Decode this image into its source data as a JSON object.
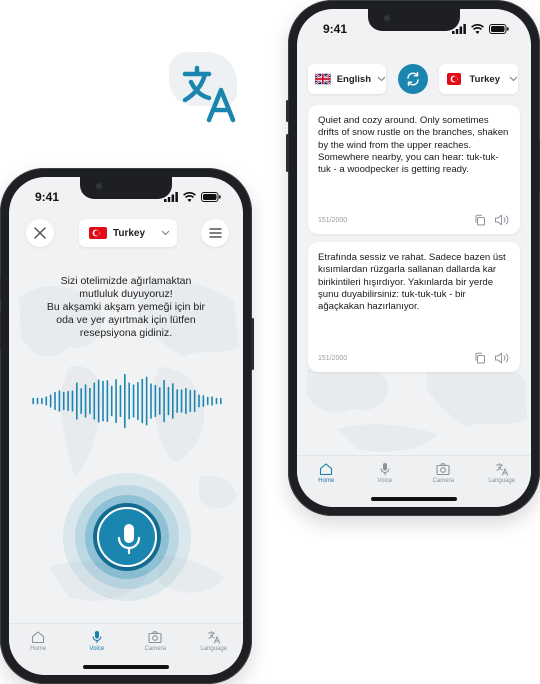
{
  "colors": {
    "accent": "#1a86b0",
    "accent_dark": "#136c8f",
    "turkey_red": "#e30a17"
  },
  "logo": {
    "icon": "translate-icon"
  },
  "voice_screen": {
    "status": {
      "time": "9:41"
    },
    "close_icon": "close-icon",
    "menu_icon": "menu-icon",
    "language": {
      "name": "Turkey",
      "flag": "flag-turkey-icon"
    },
    "phrase_lines": [
      "Sizi otelimizde ağırlamaktan",
      "mutluluk duyuyoruz!",
      "Bu akşamki akşam yemeği için bir",
      "oda ve yer ayırtmak için lütfen",
      "resepsiyona gidiniz."
    ],
    "mic_icon": "microphone-icon",
    "tabs": [
      {
        "label": "Home",
        "icon": "home-icon",
        "active": false
      },
      {
        "label": "Voice",
        "icon": "microphone-icon",
        "active": true
      },
      {
        "label": "Camera",
        "icon": "camera-icon",
        "active": false
      },
      {
        "label": "Language",
        "icon": "translate-icon",
        "active": false
      }
    ]
  },
  "text_screen": {
    "status": {
      "time": "9:41"
    },
    "source_language": {
      "name": "English",
      "flag": "flag-uk-icon"
    },
    "target_language": {
      "name": "Turkey",
      "flag": "flag-turkey-icon"
    },
    "swap_icon": "swap-icon",
    "source_card": {
      "text": "Quiet and cozy around. Only sometimes drifts of snow rustle on the branches, shaken by the wind from the upper reaches. Somewhere nearby, you can hear: tuk-tuk-tuk - a woodpecker is getting ready.",
      "count": "151/2000"
    },
    "target_card": {
      "text": "Etrafında sessiz ve rahat. Sadece bazen üst kısımlardan rüzgarla sallanan dallarda kar birikintileri hışırdıyor. Yakınlarda bir yerde şunu duyabilirsiniz: tuk-tuk-tuk - bir ağaçkakan hazırlanıyor.",
      "count": "151/2000"
    },
    "tabs": [
      {
        "label": "Home",
        "icon": "home-icon",
        "active": true
      },
      {
        "label": "Voice",
        "icon": "microphone-icon",
        "active": false
      },
      {
        "label": "Camera",
        "icon": "camera-icon",
        "active": false
      },
      {
        "label": "Language",
        "icon": "translate-icon",
        "active": false
      }
    ]
  }
}
